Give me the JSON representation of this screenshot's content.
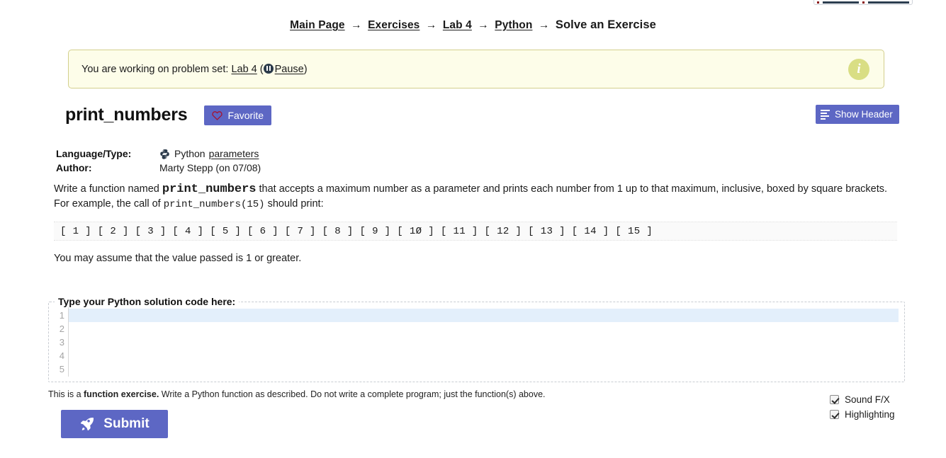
{
  "breadcrumb": {
    "items": [
      {
        "label": "Main Page",
        "link": true
      },
      {
        "label": "Exercises",
        "link": true
      },
      {
        "label": "Lab 4",
        "link": true
      },
      {
        "label": "Python",
        "link": true
      },
      {
        "label": "Solve an Exercise",
        "link": false
      }
    ],
    "separator": "→"
  },
  "notice": {
    "prefix": "You are working on problem set: ",
    "problem_set": "Lab 4",
    "open_paren": " (",
    "pause_label": "Pause",
    "close_paren": ")",
    "icon": "info-circle-icon",
    "info_glyph": "i",
    "background_color": "#fdfde9",
    "border_color": "#d3cf8d",
    "icon_color": "#d9de84"
  },
  "exercise": {
    "title": "print_numbers",
    "favorite_label": "Favorite",
    "favorite_icon": "heart-outline-icon",
    "show_header_label": "Show Header",
    "show_header_icon": "lines-icon",
    "accent_color": "#5d67c4",
    "heart_color": "#a51432"
  },
  "meta": {
    "language_label": "Language/Type:",
    "language_value": "Python",
    "language_icon": "python-logo-icon",
    "language_tag": "parameters",
    "author_label": "Author:",
    "author_value": "Marty Stepp (on 07/08)"
  },
  "description": {
    "line1_a": "Write a function named ",
    "line1_code": "print_numbers",
    "line1_b": " that accepts a maximum number as a parameter and prints each number from 1 up to that maximum, inclusive, boxed by square brackets.",
    "line2_a": "For example, the call of ",
    "line2_code": "print_numbers(15)",
    "line2_b": " should print:",
    "sample_output": "[ 1 ] [ 2 ] [ 3 ] [ 4 ] [ 5 ] [ 6 ] [ 7 ] [ 8 ] [ 9 ] [ 1Ø ] [ 11 ] [ 12 ] [ 13 ] [ 14 ] [ 15 ]",
    "assumption": "You may assume that the value passed is 1 or greater."
  },
  "editor": {
    "legend": "Type your Python solution code here:",
    "line_numbers": [
      "1",
      "2",
      "3",
      "4",
      "5"
    ],
    "code_lines": [
      "",
      "",
      "",
      "",
      ""
    ],
    "active_line": 1,
    "active_line_color": "#e3effb"
  },
  "footer": {
    "note_a": "This is a ",
    "note_bold": "function exercise.",
    "note_b": " Write a Python function as described. Do not write a complete program; just the function(s) above.",
    "submit_label": "Submit",
    "submit_icon": "rocket-icon",
    "options": [
      {
        "label": "Sound F/X",
        "checked": true
      },
      {
        "label": "Highlighting",
        "checked": true
      }
    ]
  }
}
